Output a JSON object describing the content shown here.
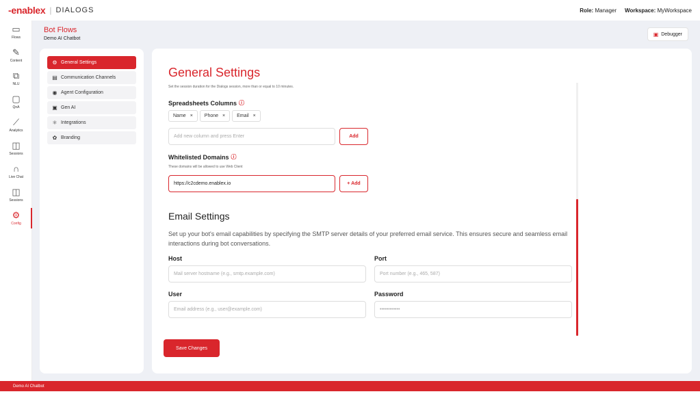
{
  "header": {
    "brand": "-enablex",
    "separator": "|",
    "product": "DIALOGS",
    "role_label": "Role:",
    "role_value": "Manager",
    "workspace_label": "Workspace:",
    "workspace_value": "MyWorkspace"
  },
  "rail": {
    "items": [
      {
        "label": "Flows",
        "icon": "flows-icon"
      },
      {
        "label": "Content",
        "icon": "pencil-icon"
      },
      {
        "label": "NLU",
        "icon": "translate-icon"
      },
      {
        "label": "QnA",
        "icon": "chat-icon"
      },
      {
        "label": "Analytics",
        "icon": "chart-icon"
      },
      {
        "label": "Sessions",
        "icon": "sessions-icon"
      },
      {
        "label": "Live Chat",
        "icon": "headset-icon"
      },
      {
        "label": "Sessions",
        "icon": "sessions-icon"
      },
      {
        "label": "Config",
        "icon": "gear-icon"
      }
    ]
  },
  "page": {
    "section": "Bot Flows",
    "bot_name": "Demo AI Chatbot",
    "debugger_label": "Debugger"
  },
  "nav": {
    "items": [
      {
        "label": "General Settings",
        "active": true
      },
      {
        "label": "Communication Channels"
      },
      {
        "label": "Agent Configuration"
      },
      {
        "label": "Gen AI"
      },
      {
        "label": "Integrations"
      },
      {
        "label": "Branding"
      }
    ]
  },
  "general": {
    "title": "General Settings",
    "session_note": "Set the session duration for the Dialogs session, more than or equal to 10 minutes.",
    "columns_label": "Spreadsheets Columns",
    "columns": [
      "Name",
      "Phone",
      "Email"
    ],
    "column_remove": "×",
    "new_column_placeholder": "Add new column and press Enter",
    "add_label": "Add",
    "domains_label": "Whitelisted Domains",
    "domains_note": "These domains will be allowed to use Web Client",
    "domain_value": "https://c2cdemo.enablex.io",
    "add_domain_label": "+ Add"
  },
  "email": {
    "title": "Email Settings",
    "description": "Set up your bot's email capabilities by specifying the SMTP server details of your preferred email service. This ensures secure and seamless email interactions during bot conversations.",
    "host_label": "Host",
    "host_placeholder": "Mail server hostname (e.g., smtp.example.com)",
    "port_label": "Port",
    "port_placeholder": "Port number (e.g., 465, 587)",
    "user_label": "User",
    "user_placeholder": "Email address (e.g., user@example.com)",
    "password_label": "Password",
    "password_value": "••••••••••••"
  },
  "actions": {
    "save_label": "Save Changes"
  },
  "footer": {
    "bot_name": "Demo AI Chatbot"
  }
}
